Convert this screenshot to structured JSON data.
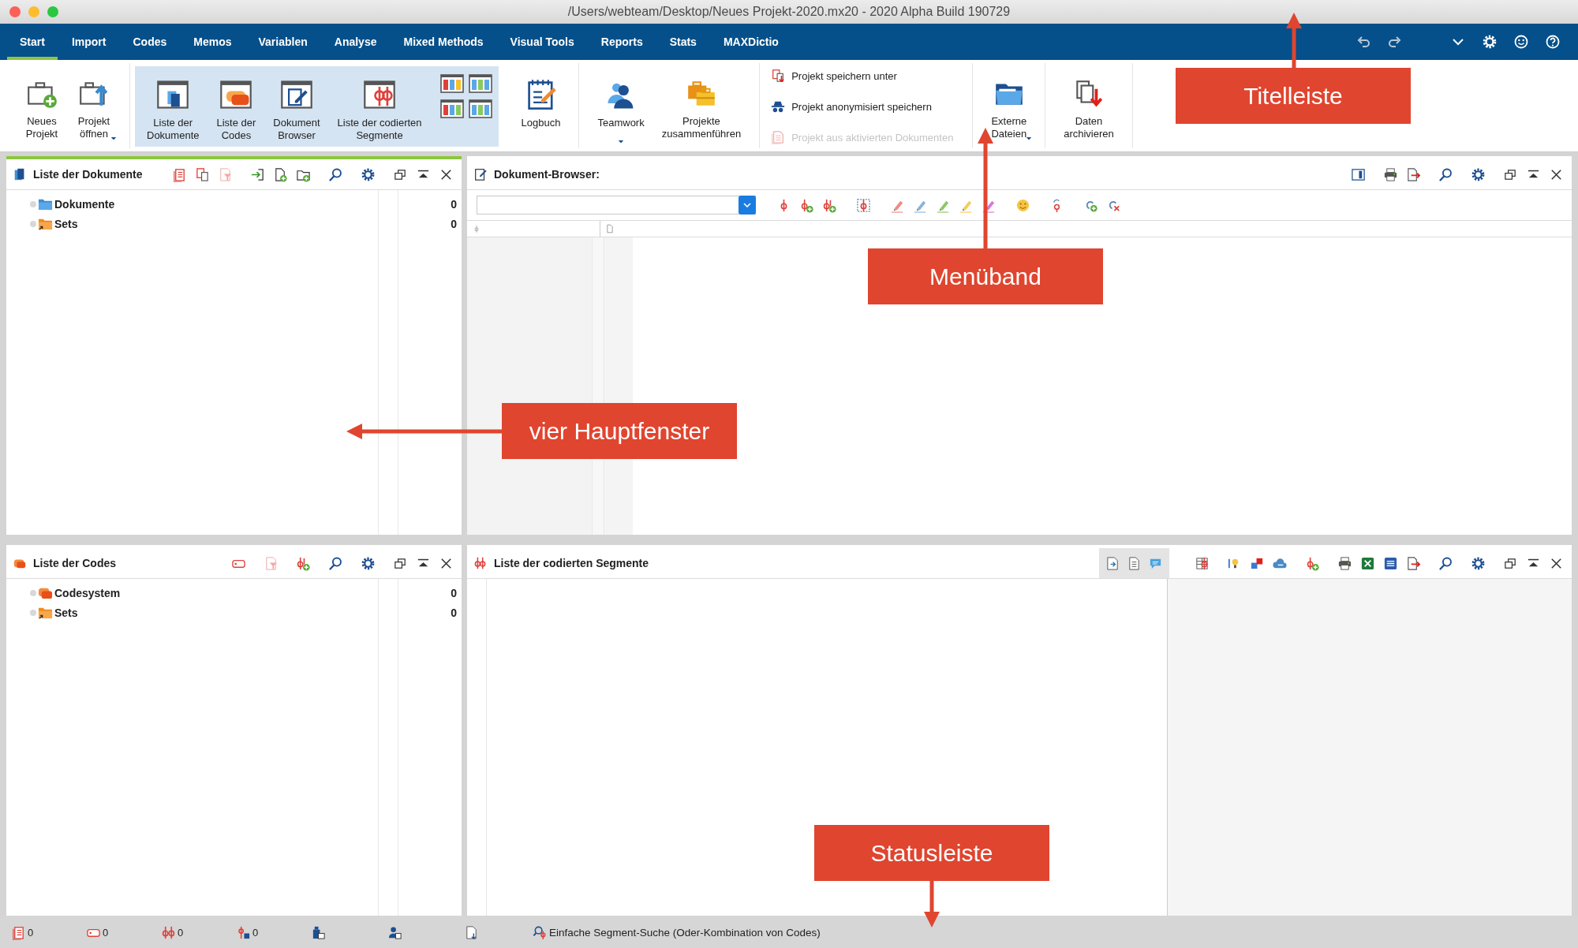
{
  "window": {
    "title": "/Users/webteam/Desktop/Neues Projekt-2020.mx20 - 2020 Alpha Build 190729"
  },
  "tabs": [
    {
      "label": "Start",
      "selected": true
    },
    {
      "label": "Import",
      "selected": false
    },
    {
      "label": "Codes",
      "selected": false
    },
    {
      "label": "Memos",
      "selected": false
    },
    {
      "label": "Variablen",
      "selected": false
    },
    {
      "label": "Analyse",
      "selected": false
    },
    {
      "label": "Mixed Methods",
      "selected": false
    },
    {
      "label": "Visual Tools",
      "selected": false
    },
    {
      "label": "Reports",
      "selected": false
    },
    {
      "label": "Stats",
      "selected": false
    },
    {
      "label": "MAXDictio",
      "selected": false
    }
  ],
  "ribbon": [
    {
      "kind": "big",
      "shaded": false,
      "items": [
        {
          "kind": "new-project",
          "label": "Neues\nProjekt",
          "dropdown": false
        },
        {
          "kind": "open-project",
          "label": "Projekt\nöffnen",
          "dropdown": true
        }
      ]
    },
    {
      "kind": "big",
      "shaded": true,
      "items": [
        {
          "kind": "doc-list",
          "label": "Liste der\nDokumente",
          "dropdown": false
        },
        {
          "kind": "code-list",
          "label": "Liste der\nCodes",
          "dropdown": false
        },
        {
          "kind": "doc-browser",
          "label": "Dokument\nBrowser",
          "dropdown": false
        },
        {
          "kind": "segments",
          "label": "Liste der codierten\nSegmente",
          "dropdown": false
        },
        {
          "kind": "layouts",
          "dropdown": false
        }
      ]
    },
    {
      "kind": "big",
      "shaded": false,
      "items": [
        {
          "kind": "logbook",
          "label": "Logbuch",
          "dropdown": false
        }
      ]
    },
    {
      "kind": "big",
      "shaded": false,
      "items": [
        {
          "kind": "teamwork",
          "label": "Teamwork",
          "dropdown": true
        },
        {
          "kind": "merge",
          "label": "Projekte\nzusammenführen",
          "dropdown": false
        }
      ]
    },
    {
      "kind": "stack",
      "shaded": false,
      "items": [
        {
          "kind": "save-as",
          "label": "Projekt speichern unter",
          "disabled": false
        },
        {
          "kind": "anonymize",
          "label": "Projekt anonymisiert speichern",
          "disabled": false
        },
        {
          "kind": "from-docs",
          "label": "Projekt aus aktivierten Dokumenten",
          "disabled": true
        }
      ]
    },
    {
      "kind": "big",
      "shaded": false,
      "items": [
        {
          "kind": "external",
          "label": "Externe\nDateien",
          "dropdown": true
        }
      ]
    },
    {
      "kind": "big",
      "shaded": false,
      "items": [
        {
          "kind": "archive",
          "label": "Daten\narchivieren",
          "dropdown": false
        }
      ]
    }
  ],
  "panels": [
    {
      "kind": "tree",
      "title": "Liste der Dokumente",
      "active": true,
      "items": [
        {
          "label": "Dokumente",
          "count": "0",
          "kind": "documents"
        },
        {
          "label": "Sets",
          "count": "0",
          "kind": "sets"
        }
      ]
    },
    {
      "kind": "browser",
      "title": "Dokument-Browser:",
      "active": false
    },
    {
      "kind": "tree",
      "title": "Liste der Codes",
      "active": false,
      "items": [
        {
          "label": "Codesystem",
          "count": "0",
          "kind": "codes"
        },
        {
          "label": "Sets",
          "count": "0",
          "kind": "sets"
        }
      ]
    },
    {
      "kind": "segments",
      "title": "Liste der codierten Segmente",
      "active": false
    }
  ],
  "status_bar": {
    "counts": [
      "0",
      "0",
      "0",
      "0"
    ],
    "search": "Einfache Segment-Suche (Oder-Kombination von Codes)"
  },
  "callouts": [
    {
      "label": "Titelleiste"
    },
    {
      "label": "Menüband"
    },
    {
      "label": "vier Hauptfenster"
    },
    {
      "label": "Statusleiste"
    }
  ]
}
